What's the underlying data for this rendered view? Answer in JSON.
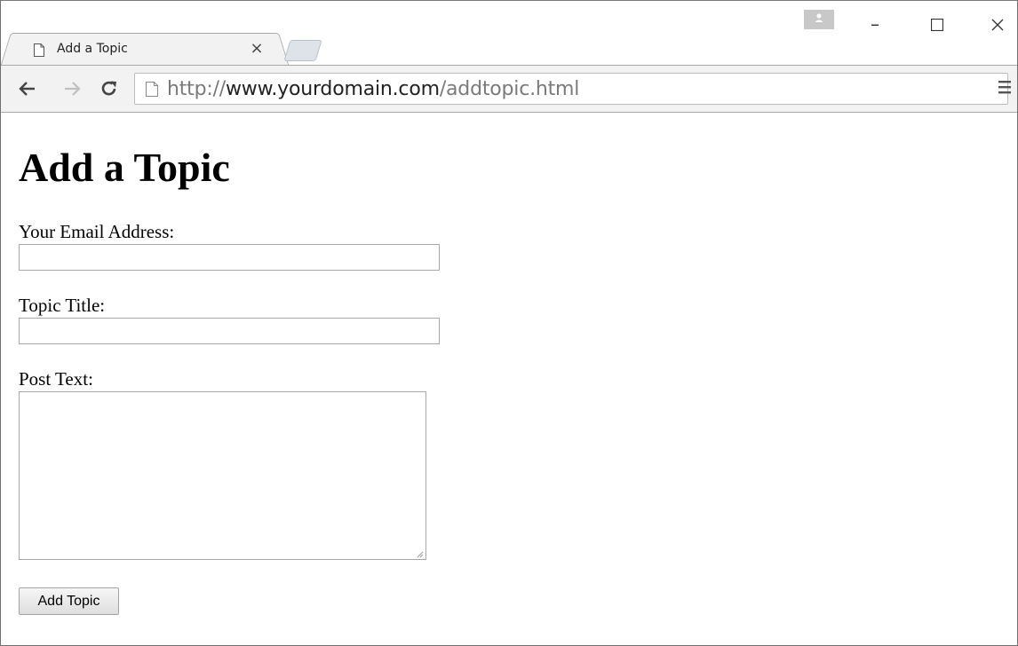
{
  "browser": {
    "tab": {
      "title": "Add a Topic",
      "close_glyph": "×"
    },
    "window_controls": {
      "minimize": "–",
      "maximize": "☐",
      "close": "✕"
    },
    "toolbar": {
      "back_icon": "arrow-left-icon",
      "forward_icon": "arrow-right-icon",
      "reload_icon": "reload-icon",
      "menu_icon": "hamburger-menu-icon"
    },
    "address": {
      "scheme": "http://",
      "host": "www.yourdomain.com",
      "path": "/addtopic.html"
    }
  },
  "page": {
    "heading": "Add a Topic",
    "form": {
      "email_label": "Your Email Address:",
      "email_value": "",
      "title_label": "Topic Title:",
      "title_value": "",
      "post_label": "Post Text:",
      "post_value": "",
      "submit_label": "Add Topic"
    }
  }
}
